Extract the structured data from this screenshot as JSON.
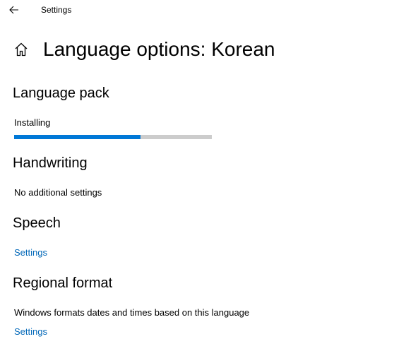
{
  "window": {
    "title": "Settings",
    "back_icon": "arrow-left-icon"
  },
  "header": {
    "home_icon": "home-icon",
    "title": "Language options: Korean"
  },
  "language_pack": {
    "heading": "Language pack",
    "status": "Installing",
    "progress": 0.64,
    "progress_color": "#0078d7",
    "track_color": "#cccccc"
  },
  "handwriting": {
    "heading": "Handwriting",
    "text": "No additional settings"
  },
  "speech": {
    "heading": "Speech",
    "link": "Settings"
  },
  "regional_format": {
    "heading": "Regional format",
    "text": "Windows formats dates and times based on this language",
    "link": "Settings"
  },
  "colors": {
    "link": "#0067b8",
    "text": "#000000",
    "background": "#ffffff"
  }
}
